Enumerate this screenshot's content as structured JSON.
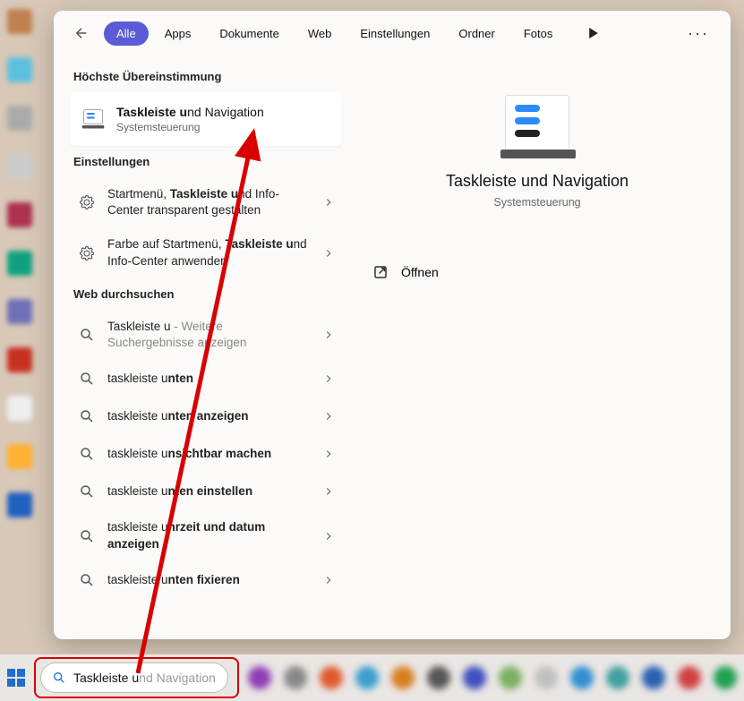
{
  "tabs": [
    "Alle",
    "Apps",
    "Dokumente",
    "Web",
    "Einstellungen",
    "Ordner",
    "Fotos"
  ],
  "active_tab_index": 0,
  "sections": {
    "best_match": "Höchste Übereinstimmung",
    "settings": "Einstellungen",
    "web": "Web durchsuchen"
  },
  "best": {
    "title_prefix": "Taskleiste u",
    "title_rest": "nd Navigation",
    "subtitle": "Systemsteuerung"
  },
  "settings_results": [
    {
      "pre": "Startmenü, ",
      "bold": "Taskleiste u",
      "post": "nd Info-Center transparent gestalten"
    },
    {
      "pre": "Farbe auf Startmenü, ",
      "bold": "Taskleiste u",
      "post": "nd Info-Center anwenden"
    }
  ],
  "web_results": [
    {
      "typed": "Taskleiste u",
      "grey": " - Weitere Suchergebnisse anzeigen"
    },
    {
      "typed": "taskleiste u",
      "bold": "nten"
    },
    {
      "typed": "taskleiste u",
      "bold": "nten anzeigen"
    },
    {
      "typed": "taskleiste u",
      "bold": "nsichtbar machen"
    },
    {
      "typed": "taskleiste u",
      "bold": "nten einstellen"
    },
    {
      "typed": "taskleiste u",
      "bold": "hrzeit und datum anzeigen"
    },
    {
      "typed": "taskleiste u",
      "bold": "nten fixieren"
    }
  ],
  "preview": {
    "title": "Taskleiste und Navigation",
    "subtitle": "Systemsteuerung",
    "open": "Öffnen"
  },
  "taskbar": {
    "search_typed": "Taskleiste u",
    "search_placeholder": "nd Navigation"
  },
  "taskbar_icon_colors": [
    "#8e3eb3",
    "#888",
    "#e05a30",
    "#3a9fcf",
    "#d68020",
    "#555",
    "#4050c0",
    "#7bb060",
    "#c0c0c0",
    "#308fd0",
    "#40a0a0",
    "#2a60b0",
    "#d04040",
    "#20a050",
    "#3070d0"
  ]
}
